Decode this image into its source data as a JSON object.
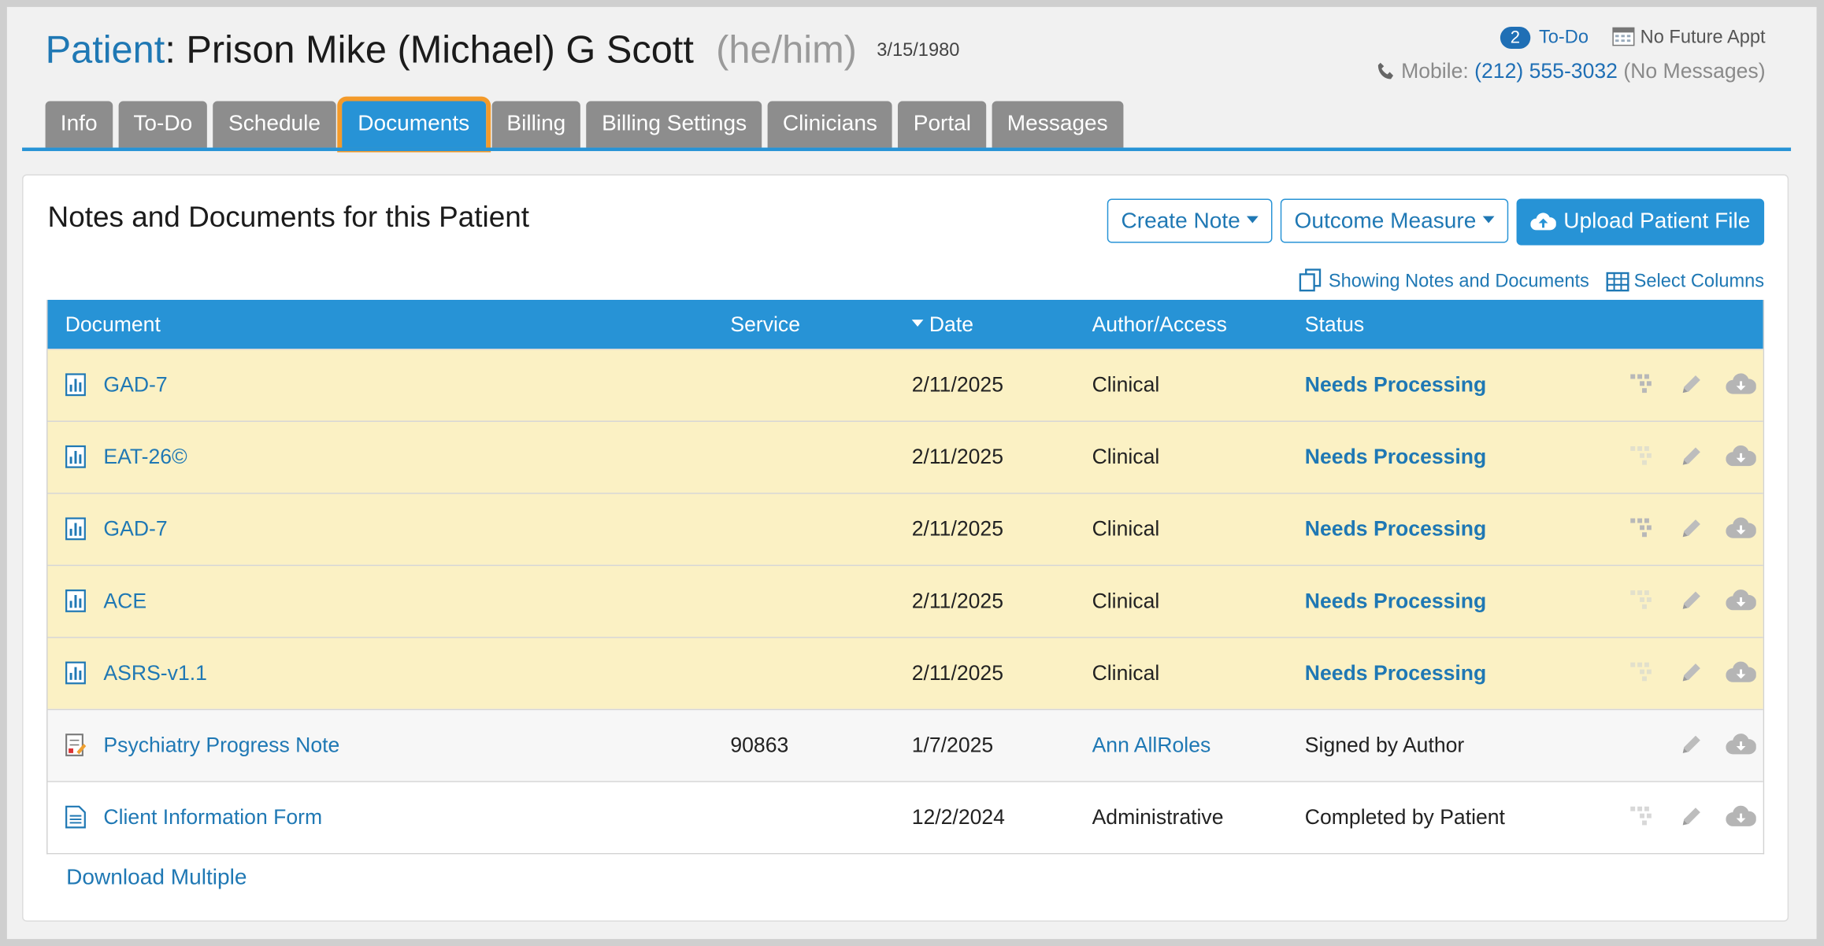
{
  "header": {
    "label": "Patient",
    "name": ": Prison Mike (Michael) G Scott",
    "pronouns": "(he/him)",
    "dob": "3/15/1980",
    "todo_count": "2",
    "todo_label": "To-Do",
    "appt_label": "No Future Appt",
    "mobile_label": "Mobile:",
    "mobile_number": "(212) 555-3032",
    "messages_note": "(No Messages)"
  },
  "tabs": [
    {
      "label": "Info"
    },
    {
      "label": "To-Do"
    },
    {
      "label": "Schedule"
    },
    {
      "label": "Documents"
    },
    {
      "label": "Billing"
    },
    {
      "label": "Billing Settings"
    },
    {
      "label": "Clinicians"
    },
    {
      "label": "Portal"
    },
    {
      "label": "Messages"
    }
  ],
  "active_tab": "Documents",
  "panel": {
    "title": "Notes and Documents for this Patient",
    "create_note": "Create Note",
    "outcome_measure": "Outcome Measure",
    "upload": "Upload Patient File",
    "showing": "Showing Notes and Documents",
    "select_columns": "Select Columns",
    "download_multiple": "Download Multiple"
  },
  "table": {
    "columns": {
      "document": "Document",
      "service": "Service",
      "date": "Date",
      "author": "Author/Access",
      "status": "Status"
    },
    "rows": [
      {
        "document": "GAD-7",
        "service": "",
        "date": "2/11/2025",
        "author": "Clinical",
        "status": "Needs Processing"
      },
      {
        "document": "EAT-26©",
        "service": "",
        "date": "2/11/2025",
        "author": "Clinical",
        "status": "Needs Processing"
      },
      {
        "document": "GAD-7",
        "service": "",
        "date": "2/11/2025",
        "author": "Clinical",
        "status": "Needs Processing"
      },
      {
        "document": "ACE",
        "service": "",
        "date": "2/11/2025",
        "author": "Clinical",
        "status": "Needs Processing"
      },
      {
        "document": "ASRS-v1.1",
        "service": "",
        "date": "2/11/2025",
        "author": "Clinical",
        "status": "Needs Processing"
      },
      {
        "document": "Psychiatry Progress Note",
        "service": "90863",
        "date": "1/7/2025",
        "author": "Ann AllRoles",
        "status": "Signed by Author"
      },
      {
        "document": "Client Information Form",
        "service": "",
        "date": "12/2/2024",
        "author": "Administrative",
        "status": "Completed by Patient"
      }
    ]
  },
  "colors": {
    "accent": "#2793d6",
    "link": "#1f78b4",
    "highlight": "#fbf1c4",
    "tab_inactive": "#8d8d8d",
    "active_outline": "#f39a2a"
  }
}
